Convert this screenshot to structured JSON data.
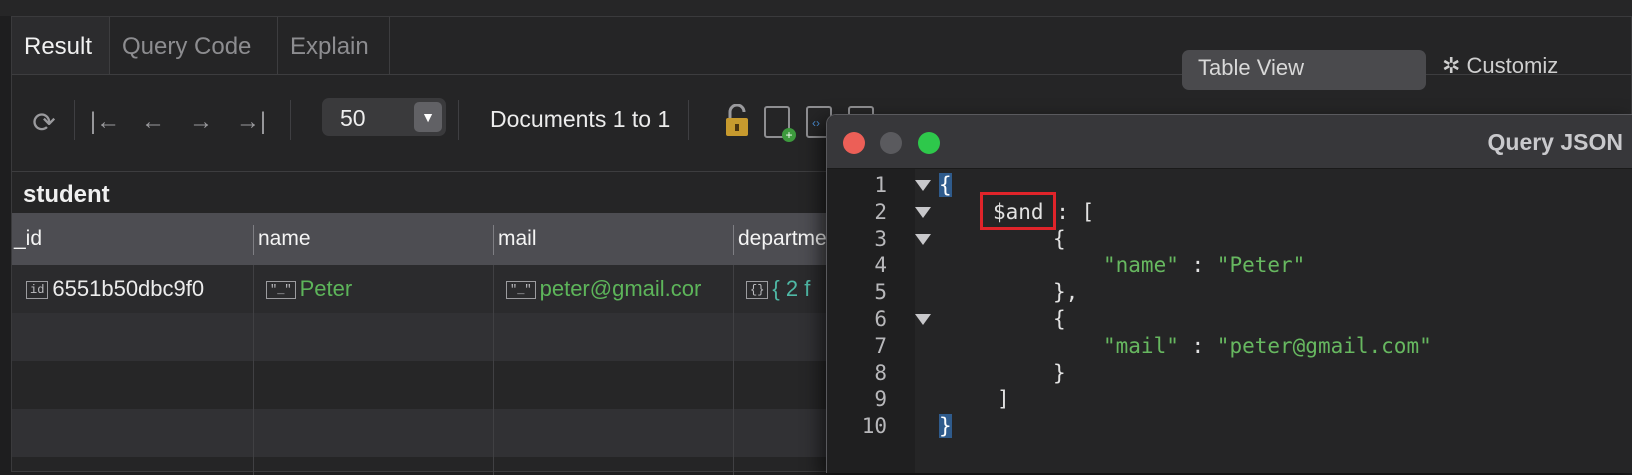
{
  "tabs": [
    {
      "label": "Result"
    },
    {
      "label": "Query Code"
    },
    {
      "label": "Explain"
    }
  ],
  "toolbar": {
    "limit_value": "50",
    "documents_label": "Documents 1 to 1",
    "view_select": "Table View",
    "customize_label": "Customiz"
  },
  "collection": {
    "name": "student"
  },
  "table": {
    "columns": [
      "_id",
      "name",
      "mail",
      "departme"
    ],
    "rows": [
      {
        "id": "6551b50dbc9f0",
        "name": "Peter",
        "mail": "peter@gmail.cor",
        "department": "{ 2 f"
      }
    ]
  },
  "query_window": {
    "title": "Query JSON",
    "line_numbers": [
      "1",
      "2",
      "3",
      "4",
      "5",
      "6",
      "7",
      "8",
      "9",
      "10"
    ],
    "lines": [
      "{",
      "$and",
      " : [",
      "{",
      "\"name\"",
      " : ",
      "\"Peter\"",
      "},",
      "{",
      "\"mail\"",
      " : ",
      "\"peter@gmail.com\"",
      "}",
      "]",
      "}"
    ]
  },
  "colors": {
    "string_green": "#5db55a",
    "object_teal": "#4fb9a6",
    "highlight_red": "#e0242a",
    "close": "#ec5f57",
    "maximize": "#2ec84b"
  }
}
